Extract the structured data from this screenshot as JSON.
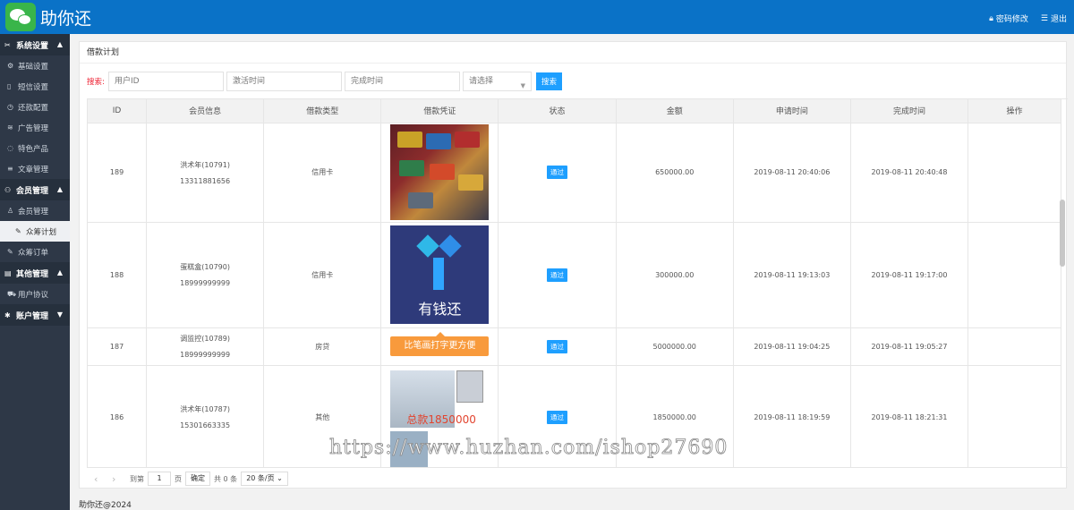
{
  "header": {
    "brand": "助你还",
    "password_label": "密码修改",
    "logout_label": "退出"
  },
  "sidebar": {
    "group1": "系统设置",
    "g1_items": [
      "基础设置",
      "短信设置",
      "还款配置",
      "广告管理",
      "特色产品",
      "文章管理"
    ],
    "group2": "会员管理",
    "g2_items": [
      "会员管理",
      "众筹计划",
      "众筹订单"
    ],
    "group3": "其他管理",
    "g3_items": [
      "用户协议"
    ],
    "group4": "账户管理"
  },
  "page": {
    "title": "借款计划"
  },
  "search": {
    "label": "搜索:",
    "user_id_placeholder": "用户ID",
    "activate_placeholder": "激活时间",
    "finish_placeholder": "完成时间",
    "select_value": "请选择",
    "button": "搜索"
  },
  "table": {
    "headers": [
      "ID",
      "会员信息",
      "借款类型",
      "借款凭证",
      "状态",
      "金额",
      "申请时间",
      "完成时间",
      "操作"
    ],
    "rows": [
      {
        "id": "189",
        "name": "洪术年(10791)",
        "phone": "13311881656",
        "type": "信用卡",
        "status": "通过",
        "amount": "650000.00",
        "apply": "2019-08-11 20:40:06",
        "finish": "2019-08-11 20:40:48"
      },
      {
        "id": "188",
        "name": "蛋糕盒(10790)",
        "phone": "18999999999",
        "type": "信用卡",
        "status": "通过",
        "amount": "300000.00",
        "apply": "2019-08-11 19:13:03",
        "finish": "2019-08-11 19:17:00"
      },
      {
        "id": "187",
        "name": "调监控(10789)",
        "phone": "18999999999",
        "type": "房贷",
        "status": "通过",
        "amount": "5000000.00",
        "apply": "2019-08-11 19:04:25",
        "finish": "2019-08-11 19:05:27"
      },
      {
        "id": "186",
        "name": "洪术年(10787)",
        "phone": "15301663335",
        "type": "其他",
        "status": "通过",
        "amount": "1850000.00",
        "apply": "2019-08-11 18:19:59",
        "finish": "2019-08-11 18:21:31"
      }
    ],
    "image_text_2": "有钱还",
    "tooltip": "比笔画打字更方便",
    "image_text_4": "总款1850000"
  },
  "pager": {
    "goto": "到第",
    "page_value": "1",
    "page_unit": "页",
    "confirm": "确定",
    "total": "共 0 条",
    "per_page": "20 条/页"
  },
  "footer": {
    "copyright": "助你还@2024"
  },
  "watermark": "https://www.huzhan.com/ishop27690",
  "colors": {
    "header": "#0a72c7",
    "sidebar": "#2e3847",
    "primary_button": "#1e9fff"
  }
}
